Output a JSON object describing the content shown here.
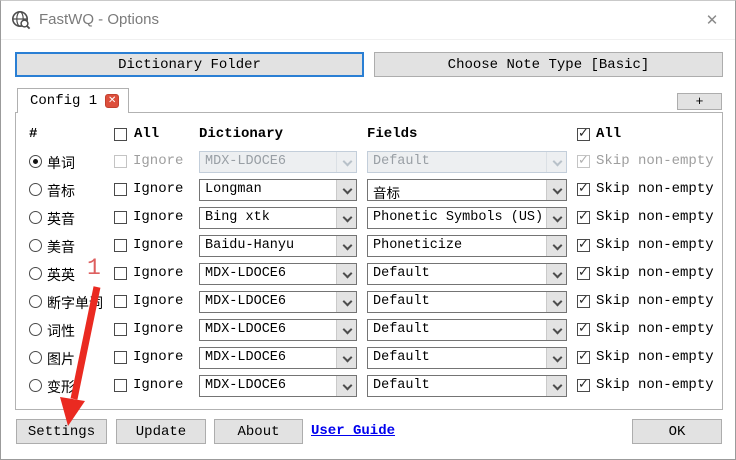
{
  "window": {
    "title": "FastWQ - Options",
    "close_glyph": "✕"
  },
  "top_buttons": {
    "dictionary_folder": "Dictionary Folder",
    "choose_note_type": "Choose Note Type [Basic]"
  },
  "tabs": {
    "config_tab": "Config 1",
    "tab_close_glyph": "✕",
    "add_tab": "+"
  },
  "table": {
    "headers": {
      "hash": "#",
      "all_left": "All",
      "dictionary": "Dictionary",
      "fields": "Fields",
      "all_right": "All"
    },
    "header_all_left_checked": false,
    "header_all_right_checked": true,
    "ignore_label": "Ignore",
    "skip_label": "Skip non-empty",
    "rows": [
      {
        "label": "单词",
        "selected": true,
        "disabled": true,
        "ignore": false,
        "dictionary": "MDX-LDOCE6",
        "field": "Default",
        "skip": true
      },
      {
        "label": "音标",
        "selected": false,
        "disabled": false,
        "ignore": false,
        "dictionary": "Longman",
        "field": "音标",
        "skip": true
      },
      {
        "label": "英音",
        "selected": false,
        "disabled": false,
        "ignore": false,
        "dictionary": "Bing xtk",
        "field": "Phonetic Symbols (US)",
        "skip": true
      },
      {
        "label": "美音",
        "selected": false,
        "disabled": false,
        "ignore": false,
        "dictionary": "Baidu-Hanyu",
        "field": "Phoneticize",
        "skip": true
      },
      {
        "label": "英英",
        "selected": false,
        "disabled": false,
        "ignore": false,
        "dictionary": "MDX-LDOCE6",
        "field": "Default",
        "skip": true
      },
      {
        "label": "断字单词",
        "selected": false,
        "disabled": false,
        "ignore": false,
        "dictionary": "MDX-LDOCE6",
        "field": "Default",
        "skip": true
      },
      {
        "label": "词性",
        "selected": false,
        "disabled": false,
        "ignore": false,
        "dictionary": "MDX-LDOCE6",
        "field": "Default",
        "skip": true
      },
      {
        "label": "图片",
        "selected": false,
        "disabled": false,
        "ignore": false,
        "dictionary": "MDX-LDOCE6",
        "field": "Default",
        "skip": true
      },
      {
        "label": "变形",
        "selected": false,
        "disabled": false,
        "ignore": false,
        "dictionary": "MDX-LDOCE6",
        "field": "Default",
        "skip": true
      }
    ]
  },
  "footer": {
    "settings": "Settings",
    "update": "Update",
    "about": "About",
    "user_guide": "User Guide",
    "ok": "OK"
  },
  "annotations": {
    "step_number": "1"
  },
  "icons": {
    "app": "globe-search-icon",
    "close": "close-icon",
    "tab_close": "tab-close-icon",
    "combo_arrow": "chevron-down-icon"
  },
  "colors": {
    "focus_border": "#2a7fd4",
    "link": "#0000ee",
    "annotation_red": "#ea2a21",
    "tab_close_red": "#dd4f3c",
    "button_fill": "#e2e2e2",
    "button_border": "#adadad"
  }
}
